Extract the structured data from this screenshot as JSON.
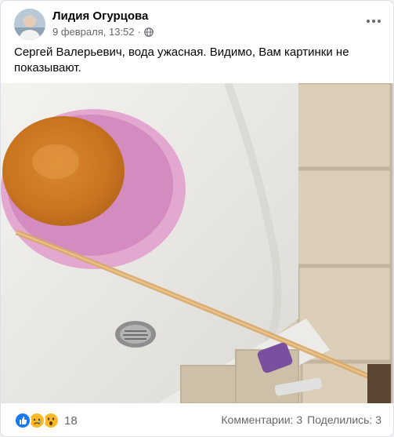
{
  "post": {
    "author": "Лидия Огурцова",
    "date": "9 февраля, 13:52",
    "separator": "·",
    "text": "Сергей Валерьевич, вода ужасная. Видимо, Вам картинки не показывают.",
    "audience_icon": "globe-icon"
  },
  "footer": {
    "reaction_icons": [
      "like-icon",
      "sad-icon",
      "wow-icon"
    ],
    "reaction_count": "18",
    "comments": "Комментарии: 3",
    "shares": "Поделились: 3"
  },
  "colors": {
    "like": "#1877f2",
    "emoji": "#f7b928",
    "secondary_text": "#65676b"
  }
}
